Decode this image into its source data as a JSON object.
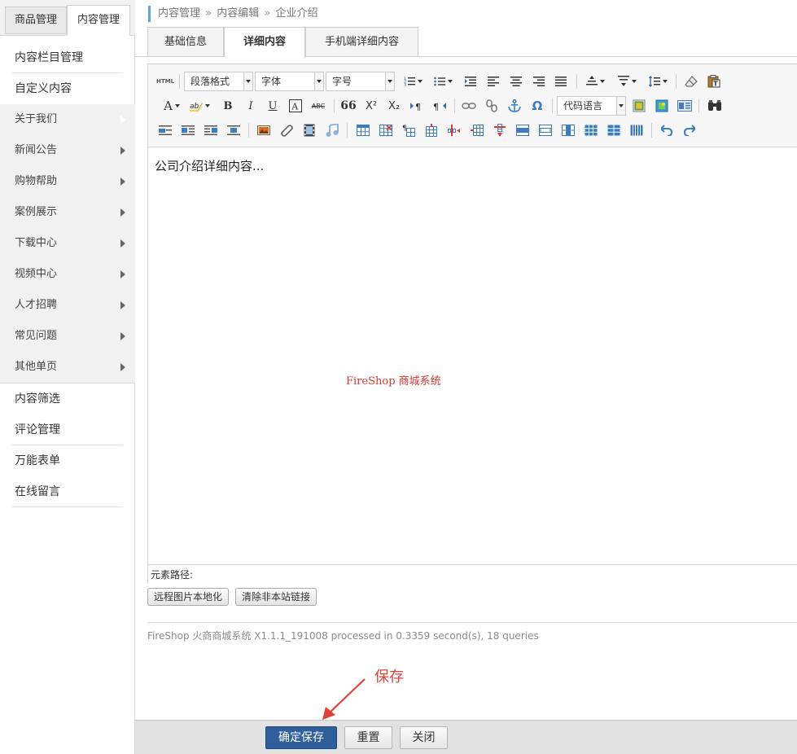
{
  "sidebar": {
    "top_tabs": [
      "商品管理",
      "内容管理"
    ],
    "items": [
      {
        "label": "内容栏目管理"
      },
      {
        "label": "自定义内容"
      }
    ],
    "sub_items": [
      {
        "label": "关于我们",
        "active": true
      },
      {
        "label": "新闻公告"
      },
      {
        "label": "购物帮助"
      },
      {
        "label": "案例展示"
      },
      {
        "label": "下载中心"
      },
      {
        "label": "视频中心"
      },
      {
        "label": "人才招聘"
      },
      {
        "label": "常见问题"
      },
      {
        "label": "其他单页"
      }
    ],
    "bottom_items": [
      {
        "label": "内容筛选"
      },
      {
        "label": "评论管理"
      },
      {
        "label": "万能表单"
      },
      {
        "label": "在线留言"
      }
    ]
  },
  "breadcrumb": {
    "parts": [
      "内容管理",
      "内容编辑",
      "企业介绍"
    ],
    "separator": "»"
  },
  "tabs": [
    "基础信息",
    "详细内容",
    "手机端详细内容"
  ],
  "toolbar": {
    "html_label": "HTML",
    "paragraph_format": "段落格式",
    "font": "字体",
    "font_size": "字号",
    "code_language": "代码语言",
    "font_color_letter": "A",
    "bold": "B",
    "italic": "I",
    "underline": "U",
    "strikethrough": "ABC",
    "quote": "66",
    "superscript": "X²",
    "subscript": "X₂",
    "omega": "Ω"
  },
  "editor": {
    "content": "公司介绍详细内容...",
    "watermark": "FireShop 商城系统",
    "element_path_label": "元素路径:"
  },
  "editor_buttons": [
    "远程图片本地化",
    "清除非本站链接"
  ],
  "footer_text": "FireShop 火商商城系统 X1.1.1_191008 processed in 0.3359 second(s), 18 queries",
  "annotation": "保存",
  "bottom_buttons": {
    "save": "确定保存",
    "reset": "重置",
    "close": "关闭"
  },
  "colors": {
    "accent": "#1f97d4",
    "save_button": "#2f5f9a",
    "annotation": "#e0403a"
  }
}
